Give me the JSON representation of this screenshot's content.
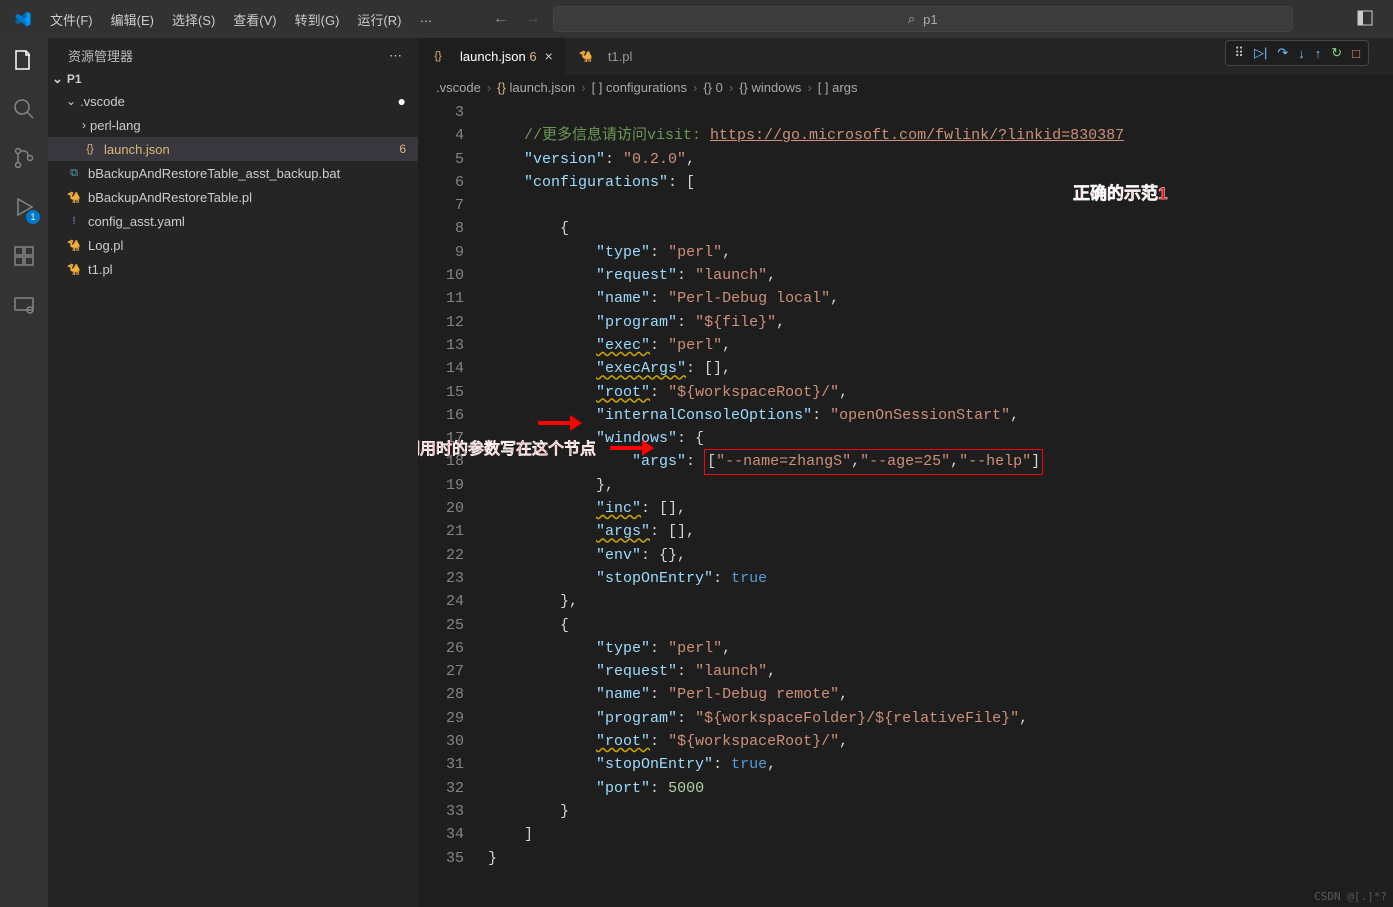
{
  "menu": {
    "file": "文件(F)",
    "edit": "编辑(E)",
    "select": "选择(S)",
    "view": "查看(V)",
    "goto": "转到(G)",
    "run": "运行(R)",
    "dots": "…"
  },
  "search": {
    "icon": "⌕",
    "text": "p1"
  },
  "sidebar": {
    "title": "资源管理器",
    "project": "P1"
  },
  "tree": [
    {
      "label": ".vscode",
      "type": "folder",
      "depth": 1,
      "open": true,
      "modified": true,
      "icon": ""
    },
    {
      "label": "perl-lang",
      "type": "folder",
      "depth": 2,
      "open": false,
      "icon": ""
    },
    {
      "label": "launch.json",
      "type": "file",
      "depth": 2,
      "icon": "{}",
      "iconcolor": "#dcb67a",
      "active": true,
      "badge": "6"
    },
    {
      "label": "bBackupAndRestoreTable_asst_backup.bat",
      "type": "file",
      "depth": 1,
      "icon": "⧉",
      "iconcolor": "#519aba"
    },
    {
      "label": "bBackupAndRestoreTable.pl",
      "type": "file",
      "depth": 1,
      "icon": "🐪",
      "iconcolor": "#519aba"
    },
    {
      "label": "config_asst.yaml",
      "type": "file",
      "depth": 1,
      "icon": "!",
      "iconcolor": "#a074c4"
    },
    {
      "label": "Log.pl",
      "type": "file",
      "depth": 1,
      "icon": "🐪",
      "iconcolor": "#519aba"
    },
    {
      "label": "t1.pl",
      "type": "file",
      "depth": 1,
      "icon": "🐪",
      "iconcolor": "#519aba"
    }
  ],
  "tabs": [
    {
      "label": "launch.json",
      "icon": "{}",
      "iconcolor": "#dcb67a",
      "active": true,
      "suffix": "6",
      "close": "×"
    },
    {
      "label": "t1.pl",
      "icon": "🐪",
      "iconcolor": "#519aba",
      "active": false
    }
  ],
  "crumbs": [
    ".vscode",
    "{}",
    "launch.json",
    "[ ]",
    "configurations",
    "{}",
    "0",
    "{}",
    "windows",
    "[ ]",
    "args"
  ],
  "lineStart": 3,
  "lineEnd": 35,
  "code": {
    "commentPrefix": "//更多信息请访问visit: ",
    "url": "https://go.microsoft.com/fwlink/?linkid=830387",
    "version": "0.2.0",
    "c1": {
      "type": "perl",
      "request": "launch",
      "name": "Perl-Debug local",
      "program": "${file}",
      "exec": "perl",
      "root": "${workspaceRoot}/",
      "ico": "openOnSessionStart",
      "args": [
        "--name=zhangS",
        "--age=25",
        "--help"
      ]
    },
    "c2": {
      "type": "perl",
      "request": "launch",
      "name": "Perl-Debug remote",
      "program": "${workspaceFolder}/${relativeFile}",
      "root": "${workspaceRoot}/",
      "port": 5000
    }
  },
  "anno": {
    "a1": "正确的示范1",
    "a2": "调用时的参数写在这个节点"
  },
  "debugbar": {
    "badge": "1"
  },
  "watermark": "CSDN @[.]*?"
}
